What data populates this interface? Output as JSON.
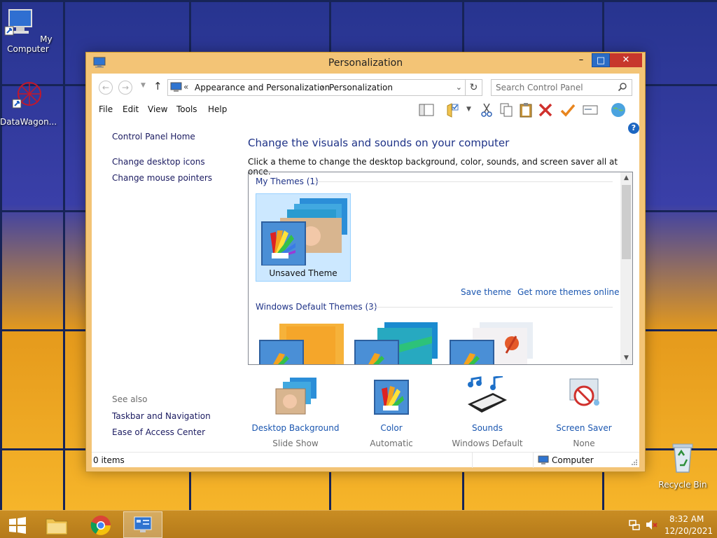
{
  "desktop": {
    "icons": [
      {
        "label": "My Computer"
      },
      {
        "label": "DataWagon..."
      },
      {
        "label": "Recycle Bin"
      }
    ]
  },
  "window": {
    "title": "Personalization",
    "controls": {
      "minimize": "–",
      "maximize": "□",
      "close": "✕"
    },
    "address": {
      "prefix": "«",
      "crumbs": [
        "Appearance and Personalization",
        "Personalization"
      ],
      "separator": "›"
    },
    "search": {
      "placeholder": "Search Control Panel"
    },
    "menu": [
      "File",
      "Edit",
      "View",
      "Tools",
      "Help"
    ],
    "left_pane": {
      "home": "Control Panel Home",
      "links": [
        "Change desktop icons",
        "Change mouse pointers"
      ],
      "see_also_title": "See also",
      "see_also": [
        "Taskbar and Navigation",
        "Ease of Access Center"
      ]
    },
    "main": {
      "title": "Change the visuals and sounds on your computer",
      "description": "Click a theme to change the desktop background, color, sounds, and screen saver all at once.",
      "my_themes_header": "My Themes (1)",
      "my_themes": [
        {
          "label": "Unsaved Theme"
        }
      ],
      "save_theme": "Save theme",
      "get_more": "Get more themes online",
      "default_themes_header": "Windows Default Themes (3)"
    },
    "bottom_items": [
      {
        "title": "Desktop Background",
        "sub": "Slide Show"
      },
      {
        "title": "Color",
        "sub": "Automatic"
      },
      {
        "title": "Sounds",
        "sub": "Windows Default"
      },
      {
        "title": "Screen Saver",
        "sub": "None"
      }
    ],
    "status": {
      "items": "0 items",
      "location": "Computer"
    },
    "help": "?"
  },
  "taskbar": {
    "time": "8:32 AM",
    "date": "12/20/2021"
  }
}
